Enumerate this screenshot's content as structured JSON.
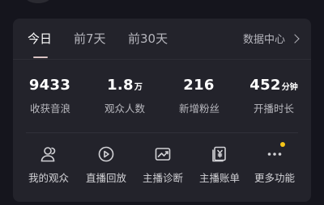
{
  "tabs": [
    {
      "label": "今日"
    },
    {
      "label": "前7天"
    },
    {
      "label": "前30天"
    }
  ],
  "data_center_label": "数据中心",
  "stats": [
    {
      "value": "9433",
      "unit": "",
      "label": "收获音浪"
    },
    {
      "value": "1.8",
      "unit": "万",
      "label": "观众人数"
    },
    {
      "value": "216",
      "unit": "",
      "label": "新增粉丝"
    },
    {
      "value": "452",
      "unit": "分钟",
      "label": "开播时长"
    }
  ],
  "actions": [
    {
      "label": "我的观众",
      "icon": "audience-icon"
    },
    {
      "label": "直播回放",
      "icon": "replay-icon"
    },
    {
      "label": "主播诊断",
      "icon": "diagnosis-icon"
    },
    {
      "label": "主播账单",
      "icon": "bill-icon"
    },
    {
      "label": "更多功能",
      "icon": "more-icon"
    }
  ],
  "colors": {
    "background": "#15151d",
    "card": "#23232b",
    "notification_dot": "#f5c518"
  }
}
